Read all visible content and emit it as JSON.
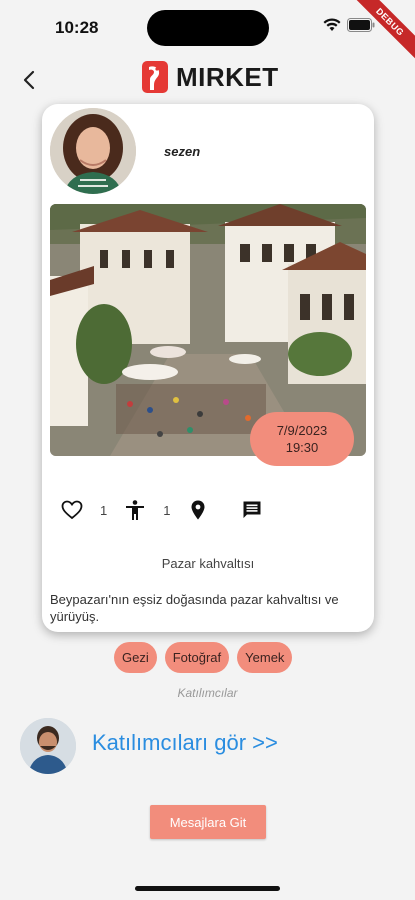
{
  "status": {
    "time": "10:28",
    "debug_label": "DEBUG"
  },
  "header": {
    "logo_text": "MIRKET"
  },
  "post": {
    "username": "sezen",
    "date": "7/9/2023",
    "time": "19:30",
    "like_count": "1",
    "attendee_count": "1",
    "title": "Pazar kahvaltısı",
    "description": "Beypazarı'nın eşsiz doğasında pazar kahvaltısı ve yürüyüş."
  },
  "tags": [
    "Gezi",
    "Fotoğraf",
    "Yemek"
  ],
  "participants": {
    "label": "Katılımcılar",
    "see_link": "Katılımcıları gör >>"
  },
  "actions": {
    "messages_button": "Mesajlara Git"
  },
  "colors": {
    "accent": "#f28d7c",
    "link": "#2a8de0",
    "brand_red": "#e53935"
  }
}
